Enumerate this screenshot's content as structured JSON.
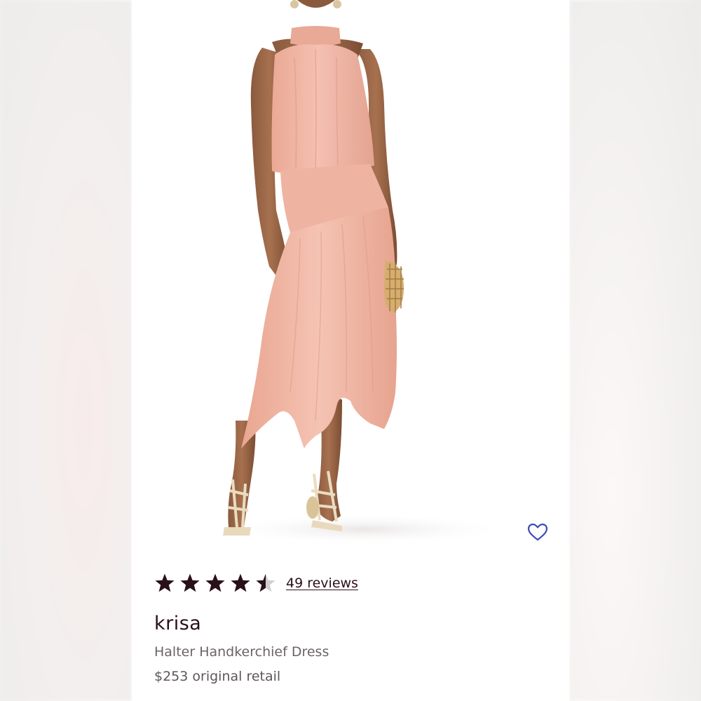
{
  "product": {
    "rating": 4.5,
    "rating_max": 5,
    "reviews_label": "49 reviews",
    "brand": "krisa",
    "name": "Halter Handkerchief Dress",
    "price_label": "$253 original retail",
    "image_alt": "model wearing a pink halter dress with handkerchief hem",
    "wishlist_icon": "heart-outline-icon"
  },
  "colors": {
    "dress": "#f0b4a4",
    "star_filled": "#2a1018",
    "star_empty": "#cfcfcf",
    "heart": "#3d4db8",
    "brand_text": "#2a1018",
    "muted_text": "#6b6466"
  }
}
